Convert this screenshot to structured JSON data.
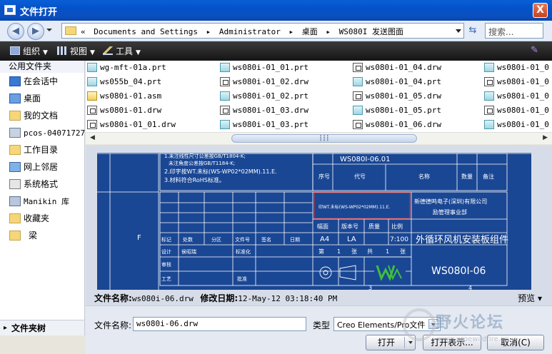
{
  "window": {
    "title": "文件打开",
    "close_glyph": "X"
  },
  "address": {
    "prefix": "«",
    "crumbs": [
      "Documents and Settings",
      "Administrator",
      "桌面",
      "WS080I 发送图面"
    ],
    "separator": "▸",
    "search_placeholder": "搜索..."
  },
  "toolbar": {
    "organize": "组织",
    "view": "视图",
    "tools": "工具"
  },
  "nav": {
    "header": "公用文件夹",
    "items": [
      {
        "label": "在会话中",
        "icon": "session-icon"
      },
      {
        "label": "桌面",
        "icon": "desktop-icon"
      },
      {
        "label": "我的文档",
        "icon": "my-documents-icon"
      },
      {
        "label": "pcos-04071727",
        "icon": "computer-icon"
      },
      {
        "label": "工作目录",
        "icon": "folder-icon"
      },
      {
        "label": "网上邻居",
        "icon": "network-icon"
      },
      {
        "label": "系统格式",
        "icon": "system-formats-icon"
      },
      {
        "label": "Manikin 库",
        "icon": "library-icon"
      },
      {
        "label": "收藏夹",
        "icon": "favorites-icon"
      },
      {
        "label": "梁",
        "icon": "folder-icon"
      }
    ],
    "footer": "文件夹树"
  },
  "files": {
    "columns": [
      [
        {
          "name": "wg-mft-01a.prt",
          "type": "prt"
        },
        {
          "name": "ws055b_04.prt",
          "type": "prt"
        },
        {
          "name": "ws080i-01.asm",
          "type": "asm"
        },
        {
          "name": "ws080i-01.drw",
          "type": "drw"
        },
        {
          "name": "ws080i-01_01.drw",
          "type": "drw"
        }
      ],
      [
        {
          "name": "ws080i-01_01.prt",
          "type": "prt"
        },
        {
          "name": "ws080i-01_02.drw",
          "type": "drw"
        },
        {
          "name": "ws080i-01_02.prt",
          "type": "prt"
        },
        {
          "name": "ws080i-01_03.drw",
          "type": "drw"
        },
        {
          "name": "ws080i-01_03.prt",
          "type": "prt"
        }
      ],
      [
        {
          "name": "ws080i-01_04.drw",
          "type": "drw"
        },
        {
          "name": "ws080i-01_04.prt",
          "type": "prt"
        },
        {
          "name": "ws080i-01_05.drw",
          "type": "drw"
        },
        {
          "name": "ws080i-01_05.prt",
          "type": "prt"
        },
        {
          "name": "ws080i-01_06.drw",
          "type": "drw"
        }
      ],
      [
        {
          "name": "ws080i-01_0",
          "type": "prt"
        },
        {
          "name": "ws080i-01_0",
          "type": "drw"
        },
        {
          "name": "ws080i-01_0",
          "type": "prt"
        },
        {
          "name": "ws080i-01_0",
          "type": "drw"
        },
        {
          "name": "ws080i-01_0",
          "type": "prt"
        }
      ]
    ]
  },
  "preview_drawing": {
    "note1": "1.未注线性尺寸公差按GB/T1804-K;",
    "note2": "未注角度公差按GB/T1184-K;",
    "note3": "2.印字按WT.未标(WS-WP02*02MM).11.E.",
    "note4": "3.材料符合RoHS标准。",
    "title_row": "WS080I-06.01",
    "cols": [
      "序号",
      "代号",
      "名称",
      "数量",
      "备注"
    ],
    "red_box": "印WT.未标(WS-WP02*02MM).11.E.",
    "company1": "新德德鸣电子(深圳)有限公司",
    "company2": "励管理事业部",
    "hdr_row": [
      "幅面",
      "版本号",
      "质量",
      "比例"
    ],
    "size": "A4",
    "version": "LA",
    "scale": "7:100",
    "part_title": "外循环风机安装板组件",
    "sheet": [
      "第",
      "1",
      "张",
      "共",
      "1",
      "张"
    ],
    "row_labels": [
      "标记",
      "处数",
      "分区",
      "文件号",
      "签名",
      "日期"
    ],
    "designer_label": "设计",
    "designer": "侯昭瑞",
    "std_label": "标准化",
    "review_label": "审核",
    "process_label": "工艺",
    "approve_label": "批准",
    "drawing_no": "WS080I-06",
    "zone_letter": "F",
    "zone_numbers": [
      "3",
      "4"
    ]
  },
  "info": {
    "name_label": "文件名称:",
    "name_value": "ws080i-06.drw",
    "date_label": "修改日期:",
    "date_value": "12-May-12 03:18:40 PM",
    "preview_label": "预览"
  },
  "bottom": {
    "filename_label": "文件名称:",
    "filename_value": "ws080i-06.drw",
    "type_label": "类型",
    "type_value": "Creo Elements/Pro文件",
    "open": "打开",
    "open_rep": "打开表示...",
    "cancel": "取消(C)"
  },
  "watermark": {
    "text": "野火论坛",
    "url": "www.proewildfire.cn"
  }
}
